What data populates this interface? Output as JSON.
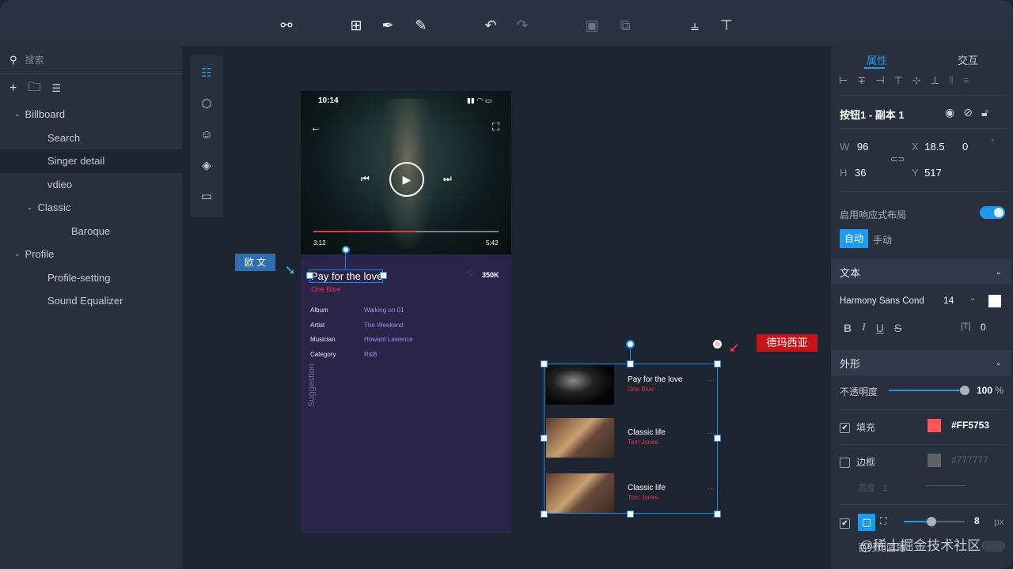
{
  "toolbar": {
    "icons": [
      "connect-icon",
      "add-frame-icon",
      "pen-icon",
      "pencil-icon",
      "undo-icon",
      "redo-icon",
      "group-icon",
      "ungroup-icon",
      "distribute-vertical-icon",
      "distribute-top-icon"
    ]
  },
  "left_panel": {
    "search_placeholder": "搜索",
    "tree": [
      {
        "label": "Billboard",
        "level": 0,
        "expanded": true
      },
      {
        "label": "Search",
        "level": 1
      },
      {
        "label": "Singer detail",
        "level": 1,
        "selected": true
      },
      {
        "label": "vdieo",
        "level": 1
      },
      {
        "label": "Classic",
        "level": 1,
        "expanded": true
      },
      {
        "label": "Baroque",
        "level": 2
      },
      {
        "label": "Profile",
        "level": 0,
        "expanded": true
      },
      {
        "label": "Profile-setting",
        "level": 1
      },
      {
        "label": "Sound Equalizer",
        "level": 1
      }
    ]
  },
  "phone": {
    "time": "10:14",
    "elapsed": "3:12",
    "duration": "5:42",
    "progress": 0.55,
    "song_title": "Pay for the love",
    "artist": "One Blue",
    "likes": "350K",
    "meta": [
      {
        "k": "Album",
        "v": "Walking on 01"
      },
      {
        "k": "Artist",
        "v": "The Weekend"
      },
      {
        "k": "Musician",
        "v": "Howard Lawence"
      },
      {
        "k": "Category",
        "v": "R&B"
      }
    ],
    "suggestion": "Suggestion"
  },
  "annotations": {
    "left_label": "欧 文",
    "right_label": "德玛西亚"
  },
  "suggestion_list": [
    {
      "title": "Pay for the love",
      "artist": "One Blue"
    },
    {
      "title": "Classic life",
      "artist": "Tom Jones"
    },
    {
      "title": "Classic life",
      "artist": "Tom Jones"
    }
  ],
  "right_panel": {
    "tabs": [
      "属性",
      "交互"
    ],
    "element_name": "按钮1 - 副本 1",
    "w_label": "W",
    "w": "96",
    "h_label": "H",
    "h": "36",
    "x_label": "X",
    "x": "18.5",
    "y_label": "Y",
    "y": "517",
    "rotation": "0",
    "deg": "°",
    "responsive_label": "启用响应式布局",
    "responsive_on": true,
    "mode_auto": "自动",
    "mode_manual": "手动",
    "text_section": "文本",
    "font": "Harmony Sans Cond",
    "font_size": "14",
    "letter_spacing": "0",
    "styles": [
      "B",
      "I",
      "U",
      "S"
    ],
    "shape_section": "外形",
    "opacity_label": "不透明度",
    "opacity": "100",
    "opacity_unit": "%",
    "opacity_value": 1.0,
    "fill_label": "填充",
    "fill_color": "#FF5753",
    "fill_hex": "#FF5753",
    "border_label": "边框",
    "border_color": "#777777",
    "border_hex": "#777777",
    "border_width_label": "宽度",
    "border_width": "1",
    "radius": "8",
    "radius_unit": "px",
    "radius_fraction": 0.45,
    "percent_radius_label": "百分比圆角"
  },
  "watermark": "@稀土掘金技术社区",
  "colors": {
    "accent": "#1e9bf0",
    "red": "#e8304a"
  }
}
